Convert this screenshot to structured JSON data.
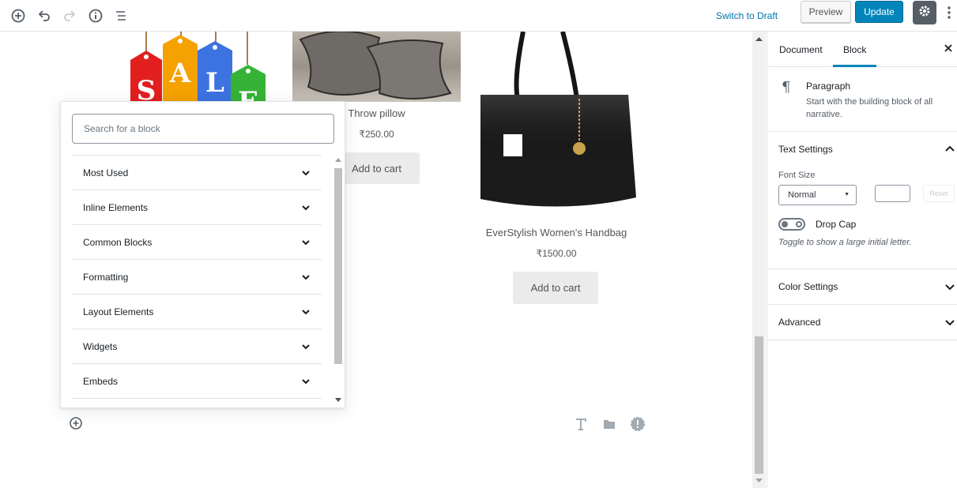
{
  "toolbar": {
    "switch_to_draft": "Switch to Draft",
    "preview": "Preview",
    "update": "Update",
    "accent": "#0085ba"
  },
  "editor": {
    "products": [
      {
        "name": "",
        "price": "",
        "cart": ""
      },
      {
        "name": "Throw pillow",
        "price": "₹250.00",
        "cart": "Add to cart"
      },
      {
        "name": "EverStylish Women's Handbag",
        "price": "₹1500.00",
        "cart": "Add to cart"
      }
    ],
    "sale_letters": [
      "S",
      "A",
      "L",
      "E"
    ]
  },
  "inserter": {
    "search_placeholder": "Search for a block",
    "panels": [
      {
        "label": "Most Used"
      },
      {
        "label": "Inline Elements"
      },
      {
        "label": "Common Blocks"
      },
      {
        "label": "Formatting"
      },
      {
        "label": "Layout Elements"
      },
      {
        "label": "Widgets"
      },
      {
        "label": "Embeds"
      }
    ]
  },
  "sidebar": {
    "tabs": [
      {
        "label": "Document"
      },
      {
        "label": "Block"
      }
    ],
    "block": {
      "title": "Paragraph",
      "description": "Start with the building block of all narrative."
    },
    "text_settings": {
      "title": "Text Settings",
      "font_size_label": "Font Size",
      "font_size_value": "Normal",
      "reset": "Reset",
      "drop_cap_label": "Drop Cap",
      "drop_cap_help": "Toggle to show a large initial letter."
    },
    "color_settings": "Color Settings",
    "advanced": "Advanced"
  }
}
